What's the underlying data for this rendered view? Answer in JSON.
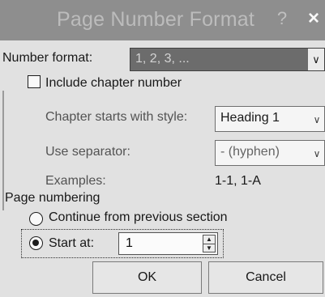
{
  "window": {
    "title": "Page Number Format",
    "help_glyph": "?",
    "close_glyph": "×"
  },
  "number_format": {
    "label": "Number format:",
    "value": "1, 2, 3, ..."
  },
  "include_chapter": {
    "label": "Include chapter number",
    "checked": false
  },
  "chapter_style": {
    "label": "Chapter starts with style:",
    "value": "Heading 1"
  },
  "separator": {
    "label": "Use separator:",
    "value": "-  (hyphen)"
  },
  "examples": {
    "label": "Examples:",
    "value": "1-1, 1-A"
  },
  "page_numbering": {
    "heading": "Page numbering",
    "continue_label": "Continue from previous section",
    "start_at_label": "Start at:",
    "start_at_value": "1",
    "selected": "start_at"
  },
  "buttons": {
    "ok": "OK",
    "cancel": "Cancel"
  }
}
